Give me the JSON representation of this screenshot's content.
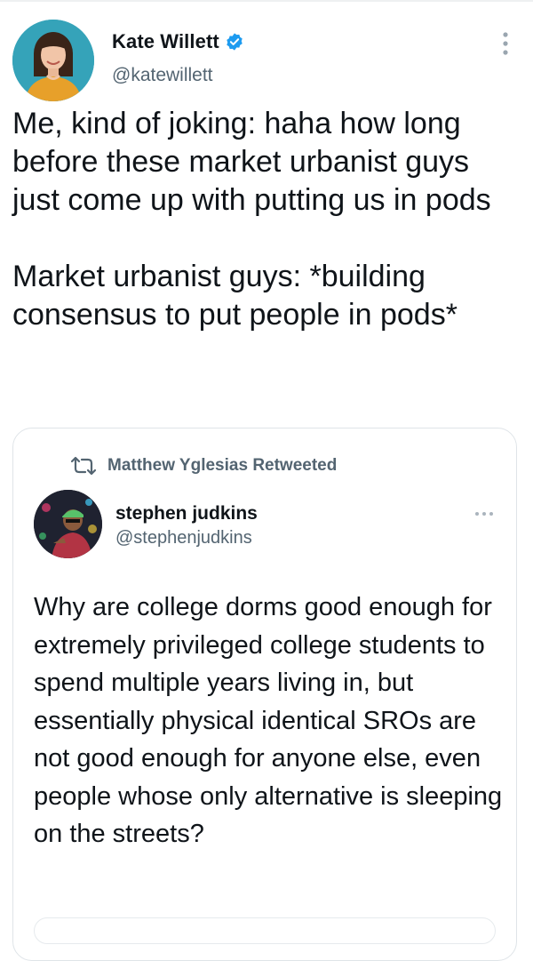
{
  "tweet": {
    "author": {
      "name": "Kate Willett",
      "handle": "@katewillett",
      "verified": true,
      "avatar_icon": "profile-photo-woman"
    },
    "text_paragraphs": [
      "Me, kind of joking: haha how long before these market urbanist guys just come up with putting us in pods",
      "Market urbanist guys: *building consensus to put people in pods*"
    ],
    "menu_icon": "more-vertical-icon"
  },
  "quote": {
    "retweet_label": "Matthew Yglesias Retweeted",
    "retweet_icon": "retweet-icon",
    "author": {
      "name": "stephen judkins",
      "handle": "@stephenjudkins",
      "avatar_icon": "profile-photo-man"
    },
    "text": "Why are college dorms good enough for extremely privileged college students to spend multiple years living in, but essentially physical identical SROs are not good enough for anyone else, even people whose only alternative is sleeping on the streets?",
    "menu_icon": "more-horizontal-icon"
  },
  "colors": {
    "text_primary": "#0f1419",
    "text_secondary": "#536471",
    "verified_blue": "#1d9bf0",
    "border": "#dfe4e8"
  }
}
